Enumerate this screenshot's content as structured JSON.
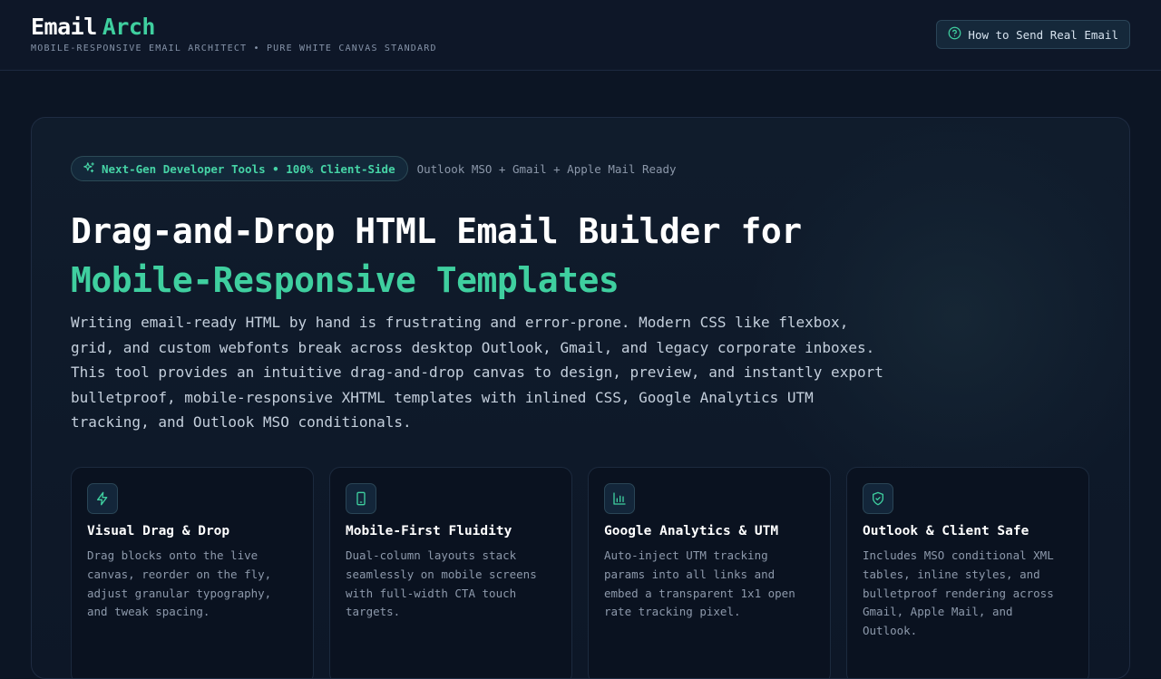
{
  "header": {
    "brand_word1": "Email",
    "brand_word2": "Arch",
    "tagline": "MOBILE-RESPONSIVE EMAIL ARCHITECT • PURE WHITE CANVAS STANDARD",
    "help_button": "How to Send Real Email",
    "help_icon": "question-circle-icon"
  },
  "hero": {
    "badge": "Next-Gen Developer Tools • 100% Client-Side",
    "badge_icon": "sparkles-icon",
    "compat_note": "Outlook MSO + Gmail + Apple Mail Ready",
    "headline_line1": "Drag-and-Drop HTML Email Builder for",
    "headline_line2": "Mobile-Responsive Templates",
    "lead_lines": [
      "Writing email-ready HTML by hand is frustrating and error-prone. Modern CSS like flexbox,",
      "grid, and custom webfonts break across desktop Outlook, Gmail, and legacy corporate inboxes.",
      "This tool provides an intuitive drag-and-drop canvas to design, preview, and instantly export",
      "bulletproof, mobile-responsive XHTML templates with inlined CSS, Google Analytics UTM",
      "tracking, and Outlook MSO conditionals."
    ]
  },
  "features": [
    {
      "icon": "lightning-bolt-icon",
      "title": "Visual Drag & Drop",
      "lines": [
        "Drag blocks onto the live",
        "canvas, reorder on the fly,",
        "adjust granular typography,",
        "and tweak spacing."
      ]
    },
    {
      "icon": "smartphone-icon",
      "title": "Mobile-First Fluidity",
      "lines": [
        "Dual-column layouts stack",
        "seamlessly on mobile screens",
        "with full-width CTA touch",
        "targets."
      ]
    },
    {
      "icon": "bar-chart-icon",
      "title": "Google Analytics & UTM",
      "lines": [
        "Auto-inject UTM tracking",
        "params into all links and",
        "embed a transparent 1x1 open",
        "rate tracking pixel."
      ]
    },
    {
      "icon": "shield-check-icon",
      "title": "Outlook & Client Safe",
      "lines": [
        "Includes MSO conditional XML",
        "tables, inline styles, and",
        "bulletproof rendering across",
        "Gmail, Apple Mail, and",
        "Outlook."
      ]
    }
  ],
  "colors": {
    "accent": "#3fcf9f",
    "background": "#0c1524",
    "card": "#0a1220"
  }
}
